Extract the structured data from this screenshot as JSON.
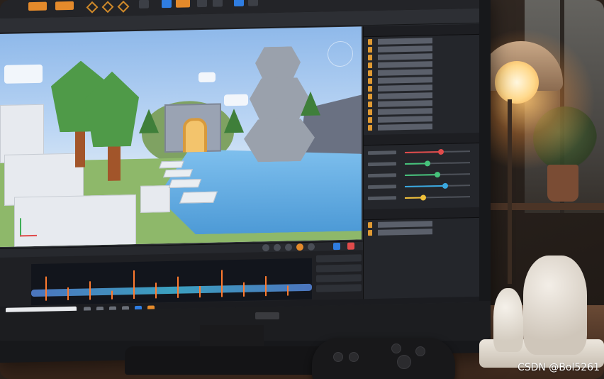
{
  "watermark": {
    "text": "CSDN @Bol5261"
  },
  "colors": {
    "accent_orange": "#e48a2b",
    "accent_blue": "#2f7de1",
    "panel_dark": "#24262b",
    "sky": "#8fb9ea",
    "water": "#4d9ad6",
    "grass": "#8eb86a"
  },
  "icons": [
    "move-tool-icon",
    "rotate-tool-icon",
    "scale-tool-icon",
    "play-icon",
    "gizmo-icon",
    "axis-icon",
    "search-icon"
  ],
  "timeline": {
    "spike_heights": [
      34,
      18,
      26,
      12,
      40,
      22,
      30,
      16,
      38,
      20,
      28,
      14
    ]
  },
  "sliders": {
    "levels": [
      0.55,
      0.35,
      0.5,
      0.62,
      0.28
    ]
  },
  "slider_colors": [
    "#e04b4b",
    "#46c37b",
    "#46c37b",
    "#3aa8e0",
    "#f0c03a"
  ]
}
